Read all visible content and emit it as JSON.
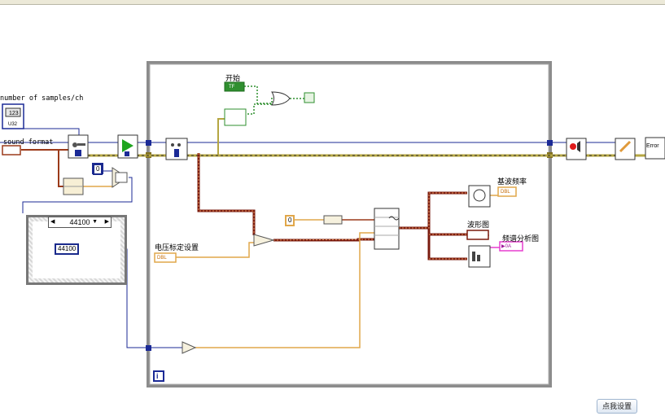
{
  "labels": {
    "samples_per_ch": "number of samples/ch",
    "sound_format": "sound format",
    "start": "开始",
    "fundamental_freq": "基波频率",
    "waveform": "波形图",
    "spectrum": "频谱分析图",
    "voltage_calib": "电压标定设置"
  },
  "terminals": {
    "u32": "U32",
    "i32_val": "123",
    "tf": "TF",
    "dbl": "DBL",
    "cluster": "▶0A"
  },
  "constants": {
    "zero_a": "0",
    "zero_b": "0",
    "rate_a": "44100",
    "rate_b": "44100"
  },
  "case_selector": {
    "value": "44100",
    "arrow_left": "◀",
    "arrow_right": "▶",
    "dropdown": "▼"
  },
  "loop": {
    "iteration": "i"
  },
  "error": {
    "label": "Error"
  },
  "bottom_button": "点我设置",
  "colors": {
    "error_wire": "#b5a642",
    "dynamic_wire": "#7a1b0f",
    "numeric_wire": "#e1a74a",
    "int_wire": "#1b2a96",
    "bool_wire": "#2f8f2f",
    "loop_frame": "#8c8c8c"
  }
}
